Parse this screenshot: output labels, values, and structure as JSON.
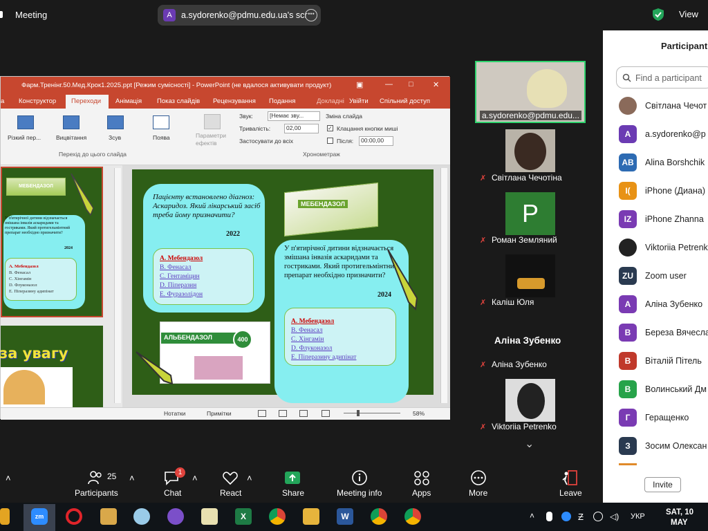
{
  "topbar": {
    "title": "Meeting",
    "share_avatar": "A",
    "share_text": "a.sydorenko@pdmu.edu.ua's scr",
    "more": "•••",
    "view": "View"
  },
  "ppt": {
    "title": "Фарм.Тренінг.50.Мед.Крок1.2025.ppt [Режим сумісності] - PowerPoint (не вдалося активувати продукт)",
    "tabs": [
      "а",
      "Конструктор",
      "Переходи",
      "Анімація",
      "Показ слайдів",
      "Рецензування",
      "Подання",
      "Докладні",
      "Увійти",
      "Спільний доступ"
    ],
    "ribbon": {
      "transitions": [
        "Різкий пер...",
        "Вицвітання",
        "Зсув",
        "Поява"
      ],
      "effect_params": "Параметри ефектів",
      "sound_label": "Звук:",
      "sound_value": "[Немає зву...",
      "duration_label": "Тривалість:",
      "duration_value": "02,00",
      "apply_all": "Застосувати до всіх",
      "change_slide": "Зміна слайда",
      "on_click": "Клацання кнопки миші",
      "after_label": "Після:",
      "after_value": "00:00,00",
      "group1": "Перехід до цього слайда",
      "group2": "Хронометраж"
    },
    "status": {
      "notes": "Нотатки",
      "comments": "Примітки",
      "zoom": "58%"
    },
    "slide": {
      "q1": "Пацієнту встановлено діагноз: Аскаридоз. Який лікарський засіб треба йому призначити?",
      "q1_year": "2022",
      "q1_options": [
        "A. Мебендазол",
        "B. Фенасал",
        "C. Гентаміцин",
        "D. Піперазин",
        "E. Фуразолідон"
      ],
      "drug_label1": "МЕБЕНДАЗОЛ",
      "drug_label2": "АЛЬБЕНДАЗОЛ",
      "drug_badge": "400",
      "q2": "У п'ятирічної дитини відзначається змішана інвазія аскаридами та гостриками. Який протигельмінтний препарат необхідно призначити?",
      "q2_year": "2024",
      "q2_options": [
        "A. Мебендазол",
        "B. Фенасал",
        "C. Хінгамін",
        "D. Флуконазол",
        "E. Піперазину адипінат"
      ]
    },
    "thumb": {
      "drug": "МЕБЕНДАЗОЛ",
      "q": "У п'ятирічної дитини відзначається змішана інвазія аскаридами та гостриками. Який протигельмінтний препарат необхідно призначити?",
      "year": "2024",
      "options": [
        "A. Мебендазол",
        "B. Фенасал",
        "C. Хінгамін",
        "D. Флуконазол",
        "E. Піперазину адипінат"
      ],
      "title2": "за увагу"
    }
  },
  "gallery": {
    "active_name": "a.sydorenko@pdmu.edu...",
    "names": [
      "Світлана Чечотіна",
      "Роман Земляний",
      "Каліш Юля",
      "Аліна Зубенко",
      "Viktoriia Petrenko"
    ],
    "big_name": "Аліна Зубенко",
    "roman_initial": "P"
  },
  "panel": {
    "title": "Participant",
    "search_placeholder": "Find a participant",
    "participants": [
      {
        "initials": "",
        "name": "Світлана Чечот",
        "color": "#8a6a5a"
      },
      {
        "initials": "A",
        "name": "a.sydorenko@p",
        "color": "#6b3bb3"
      },
      {
        "initials": "AB",
        "name": "Alina Borshchik",
        "color": "#2d6bb3"
      },
      {
        "initials": "I(",
        "name": "iPhone (Диана)",
        "color": "#e89215"
      },
      {
        "initials": "IZ",
        "name": "iPhone Zhanna",
        "color": "#7a3bb3"
      },
      {
        "initials": "",
        "name": "Viktoriia Petrenk",
        "color": "#222222"
      },
      {
        "initials": "ZU",
        "name": "Zoom user",
        "color": "#2a3a50"
      },
      {
        "initials": "A",
        "name": "Аліна Зубенко",
        "color": "#7a3bb3"
      },
      {
        "initials": "B",
        "name": "Береза Вячесла",
        "color": "#7a3bb3"
      },
      {
        "initials": "B",
        "name": "Віталій Пітель",
        "color": "#c0392b"
      },
      {
        "initials": "B",
        "name": "Волинський Дм",
        "color": "#27a34a"
      },
      {
        "initials": "Г",
        "name": "Геращенко",
        "color": "#7a3bb3"
      },
      {
        "initials": "З",
        "name": "Зосим Олексан",
        "color": "#2a3a50"
      }
    ],
    "invite": "Invite"
  },
  "controls": {
    "participants": "Participants",
    "participants_count": "25",
    "chat": "Chat",
    "chat_badge": "1",
    "react": "React",
    "share": "Share",
    "meeting_info": "Meeting info",
    "apps": "Apps",
    "more": "More",
    "leave": "Leave"
  },
  "taskbar": {
    "lang": "УКР",
    "date1": "SAT, 10",
    "date2": "MAY"
  }
}
